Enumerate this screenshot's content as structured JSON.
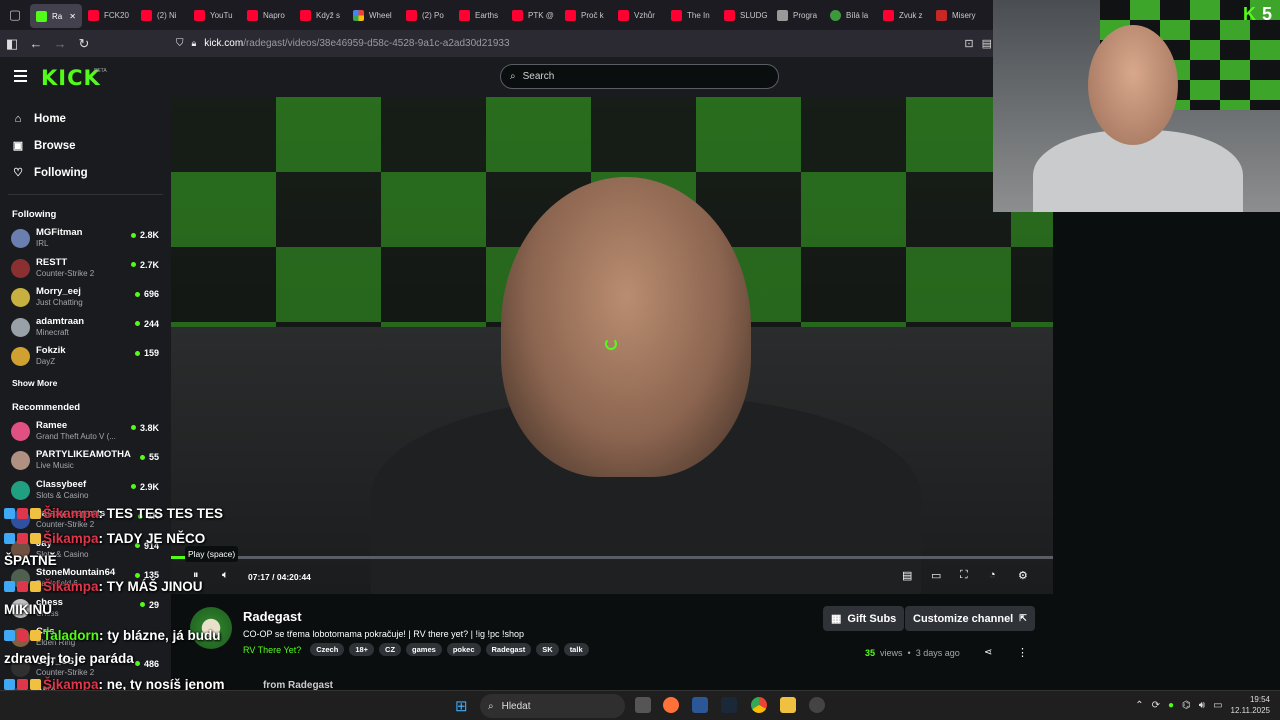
{
  "browser": {
    "tabs": [
      {
        "label": "Ra",
        "icon": "kick",
        "active": true
      },
      {
        "label": "FCK20",
        "icon": "yt"
      },
      {
        "label": "(2) Ni",
        "icon": "yt"
      },
      {
        "label": "YouTu",
        "icon": "yt"
      },
      {
        "label": "Napro",
        "icon": "yt"
      },
      {
        "label": "Když s",
        "icon": "yt"
      },
      {
        "label": "Wheel",
        "icon": "multi"
      },
      {
        "label": "(2) Po",
        "icon": "yt"
      },
      {
        "label": "Earths",
        "icon": "yt"
      },
      {
        "label": "PTK @",
        "icon": "yt"
      },
      {
        "label": "Proč k",
        "icon": "yt"
      },
      {
        "label": "Vzhůr",
        "icon": "yt"
      },
      {
        "label": "The In",
        "icon": "yt"
      },
      {
        "label": "SLUDG",
        "icon": "yt"
      },
      {
        "label": "Progra",
        "icon": "grey"
      },
      {
        "label": "Bílá la",
        "icon": "green"
      },
      {
        "label": "Zvuk z",
        "icon": "yt"
      },
      {
        "label": "Misery",
        "icon": "red"
      }
    ],
    "url_host": "kick.com",
    "url_path": "/radegast/videos/38e46959-d58c-4528-9a1c-a2ad30d21933"
  },
  "header": {
    "logo": "KICK",
    "beta": "BETA",
    "search_placeholder": "Search"
  },
  "sidebar": {
    "nav": [
      {
        "label": "Home",
        "icon": "home-icon",
        "glyph": "⌂"
      },
      {
        "label": "Browse",
        "icon": "browse-icon",
        "glyph": "▣"
      },
      {
        "label": "Following",
        "icon": "heart-icon",
        "glyph": "♡"
      }
    ],
    "following_heading": "Following",
    "following": [
      {
        "name": "MGFitman",
        "game": "IRL",
        "viewers": "2.8K",
        "color": "#6a7fb0"
      },
      {
        "name": "RESTT",
        "game": "Counter-Strike 2",
        "viewers": "2.7K",
        "color": "#8a3030"
      },
      {
        "name": "Morry_eej",
        "game": "Just Chatting",
        "viewers": "696",
        "color": "#c8b040"
      },
      {
        "name": "adamtraan",
        "game": "Minecraft",
        "viewers": "244",
        "color": "#9aa0a8"
      },
      {
        "name": "Fokzik",
        "game": "DayZ",
        "viewers": "159",
        "color": "#d0a030"
      }
    ],
    "show_more": "Show More",
    "recommended_heading": "Recommended",
    "recommended": [
      {
        "name": "Ramee",
        "game": "Grand Theft Auto V (...",
        "viewers": "3.8K",
        "color": "#e05080"
      },
      {
        "name": "PARTYLIKEAMOTHA",
        "game": "Live Music",
        "viewers": "55",
        "color": "#b09080"
      },
      {
        "name": "Classybeef",
        "game": "Slots & Casino",
        "viewers": "2.9K",
        "color": "#20a080"
      },
      {
        "name": "galaxy_esports",
        "game": "Counter-Strike 2",
        "viewers": "1K",
        "color": "#3050a0"
      },
      {
        "name": "Jay",
        "game": "Slots & Casino",
        "viewers": "914",
        "color": "#705040"
      },
      {
        "name": "StoneMountain64",
        "game": "Battlefield 6",
        "viewers": "135",
        "color": "#506050"
      },
      {
        "name": "chess",
        "game": "Chess",
        "viewers": "29",
        "color": "#c0c0c0"
      },
      {
        "name": "Cris",
        "game": "Elden Ring",
        "viewers": "",
        "color": "#806040"
      },
      {
        "name": "CCT_CS",
        "game": "Counter-Strike 2",
        "viewers": "486",
        "color": "#303030"
      },
      {
        "name": "ANA",
        "game": "ANA - COI",
        "viewers": "",
        "color": "#404060"
      }
    ]
  },
  "player": {
    "tooltip": "Play (space)",
    "time_current": "07:17",
    "time_sep": "/",
    "time_total": "04:20:44",
    "progress_fraction": 0.028
  },
  "webcam": {
    "logo": "K",
    "count": "5"
  },
  "channel": {
    "name": "Radegast",
    "title": "CO-OP se třema lobotomama pokračuje! | RV there yet? | !ig !pc !shop",
    "category": "RV There Yet?",
    "tags": [
      "Czech",
      "18+",
      "CZ",
      "games",
      "pokec",
      "Radegast",
      "SK",
      "talk"
    ],
    "gift_subs": "Gift Subs",
    "customize": "Customize channel",
    "views_count": "35",
    "views_label": "views",
    "bullet": "•",
    "posted": "3 days ago",
    "more_from": "from Radegast"
  },
  "chat": [
    {
      "user": "Šikampa",
      "text": ": TES TES TES TES"
    },
    {
      "user": "Šikampa",
      "text": ": TADY JE NĚCO"
    },
    {
      "user": "",
      "text": "ŠPATNĚ"
    },
    {
      "user": "Šikampa",
      "text": ": TY MÁŠ JINOU"
    },
    {
      "user": "",
      "text": "MIKINU"
    },
    {
      "user": "Taladorn",
      "text": ": ty blázne, já budu",
      "green": true
    },
    {
      "user": "",
      "text": "zdravej, to je paráda"
    },
    {
      "user": "Šikampa",
      "text": ": ne, ty nosíš jenom"
    },
    {
      "user": "",
      "text": "natalka a call of duty"
    }
  ],
  "taskbar": {
    "search": "Hledat",
    "time": "19:54",
    "date": "12.11.2025"
  }
}
